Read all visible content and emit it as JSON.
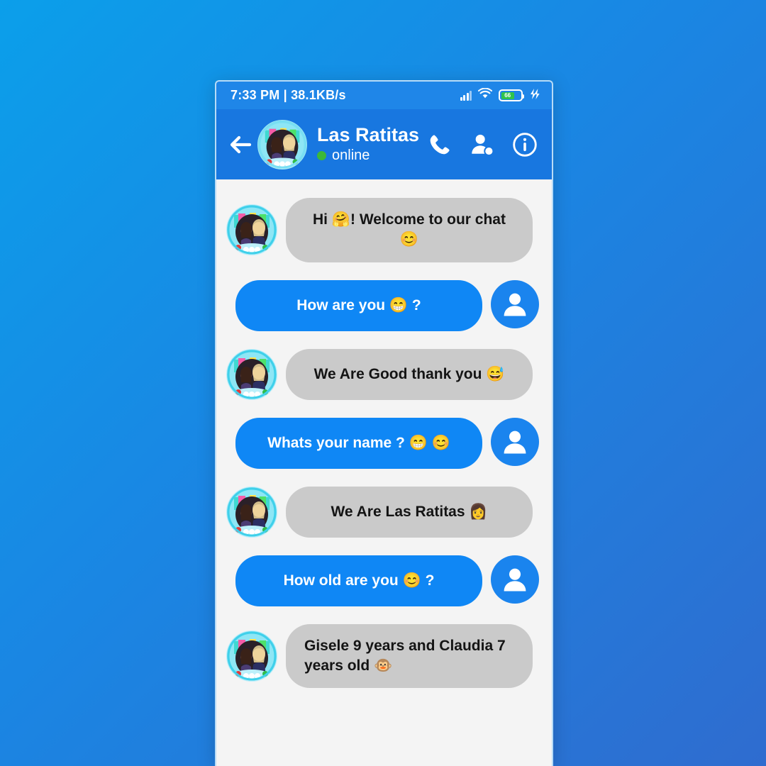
{
  "background": {
    "gradient_from": "#0b9fea",
    "gradient_to": "#2f6ccf"
  },
  "status_bar": {
    "time_and_speed": "7:33 PM | 38.1KB/s",
    "signal_icon": "signal-bars-icon",
    "wifi_icon": "wifi-icon",
    "battery_level": "66",
    "charging_icon": "charging-bolt-icon"
  },
  "app_bar": {
    "back_icon": "back-arrow-icon",
    "avatar_icon": "contact-avatar",
    "contact_name": "Las Ratitas",
    "status_text": "online",
    "status_color": "#3cb838",
    "call_icon": "phone-call-icon",
    "add_contact_icon": "add-person-icon",
    "info_icon": "info-circle-icon",
    "header_color": "#1877e0"
  },
  "chat": {
    "background_color": "#f4f4f4",
    "incoming_bubble_color": "#cacaca",
    "outgoing_bubble_color": "#0f87f5",
    "messages": [
      {
        "side": "incoming",
        "text": "Hi 🤗! Welcome to our chat 😊",
        "avatar": "contact-avatar"
      },
      {
        "side": "outgoing",
        "text": "How are you 😁 ?",
        "avatar": "user-avatar-icon"
      },
      {
        "side": "incoming",
        "text": "We Are Good thank you 😅",
        "avatar": "contact-avatar"
      },
      {
        "side": "outgoing",
        "text": "Whats your name ? 😁 😊",
        "avatar": "user-avatar-icon"
      },
      {
        "side": "incoming",
        "text": "We Are Las Ratitas 👩",
        "avatar": "contact-avatar"
      },
      {
        "side": "outgoing",
        "text": "How old are you 😊 ?",
        "avatar": "user-avatar-icon"
      },
      {
        "side": "incoming",
        "text": "Gisele 9 years and Claudia 7 years old 🐵",
        "avatar": "contact-avatar"
      }
    ]
  }
}
